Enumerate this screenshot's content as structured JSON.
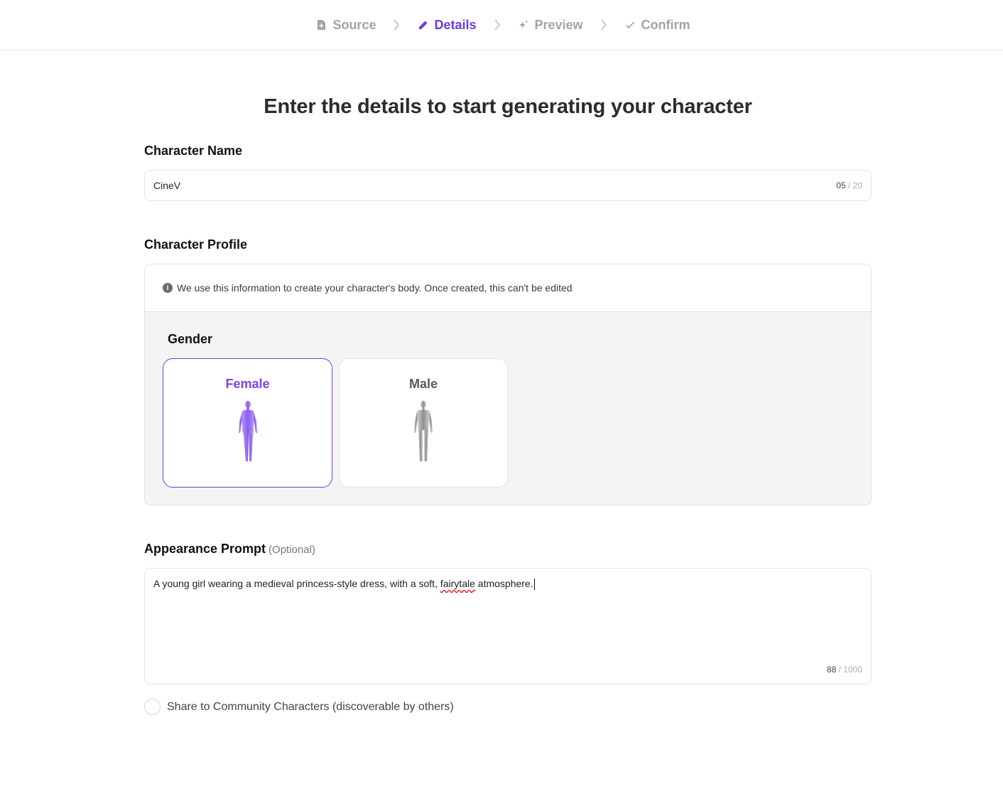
{
  "stepper": {
    "steps": [
      {
        "label": "Source",
        "icon": "file-plus-icon",
        "active": false
      },
      {
        "label": "Details",
        "icon": "pencil-icon",
        "active": true
      },
      {
        "label": "Preview",
        "icon": "sparkle-icon",
        "active": false
      },
      {
        "label": "Confirm",
        "icon": "check-icon",
        "active": false
      }
    ]
  },
  "page_title": "Enter the details to start generating your character",
  "character_name": {
    "label": "Character Name",
    "value": "CineV",
    "count": "05",
    "max": "/ 20"
  },
  "character_profile": {
    "label": "Character Profile",
    "note": "We use this information to create your character's body. Once created, this can't be edited",
    "gender_label": "Gender",
    "options": [
      {
        "label": "Female",
        "selected": true
      },
      {
        "label": "Male",
        "selected": false
      }
    ]
  },
  "appearance_prompt": {
    "label": "Appearance Prompt",
    "optional": "(Optional)",
    "value_before": "A young girl wearing a medieval princess-style dress, with a soft, ",
    "value_misspelled": "fairytale",
    "value_after": " atmosphere.",
    "count": "88",
    "max": "/ 1000"
  },
  "share": {
    "label": "Share to Community Characters (discoverable by others)",
    "checked": false
  },
  "colors": {
    "accent": "#6d3ae8",
    "muted": "#a3a3a3",
    "panel_bg": "#f4f4f4"
  }
}
